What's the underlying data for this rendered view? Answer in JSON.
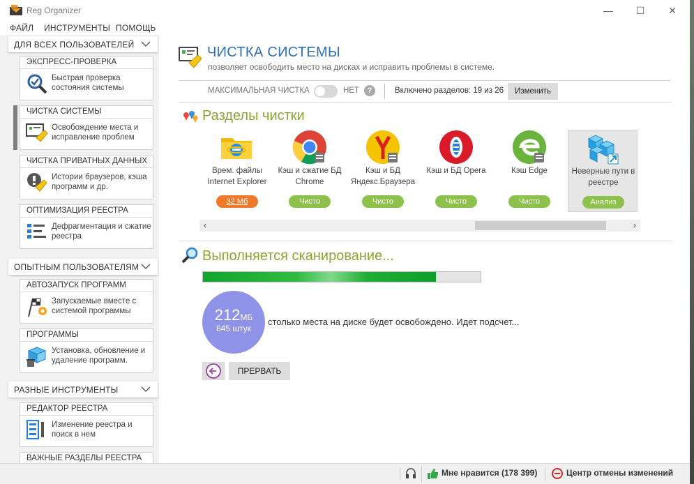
{
  "window": {
    "title": "Reg Organizer",
    "controls": {
      "minimize": "—",
      "maximize": "☐",
      "close": "✕"
    }
  },
  "menu": [
    "ФАЙЛ",
    "ИНСТРУМЕНТЫ",
    "ПОМОЩЬ"
  ],
  "sidebar": {
    "groups": [
      {
        "label": "ДЛЯ ВСЕХ ПОЛЬЗОВАТЕЛЕЙ",
        "items": [
          {
            "title": "ЭКСПРЕСС-ПРОВЕРКА",
            "desc": "Быстрая проверка состояния системы",
            "icon": "magnifier-check-icon"
          },
          {
            "title": "ЧИСТКА СИСТЕМЫ",
            "desc": "Освобождение места и исправление проблем",
            "icon": "system-clean-icon",
            "active": true
          },
          {
            "title": "ЧИСТКА ПРИВАТНЫХ ДАННЫХ",
            "desc": "Истории браузеров, кэша программ и др.",
            "icon": "privacy-clean-icon"
          },
          {
            "title": "ОПТИМИЗАЦИЯ РЕЕСТРА",
            "desc": "Дефрагментация и сжатие реестра",
            "icon": "registry-defrag-icon"
          }
        ]
      },
      {
        "label": "ОПЫТНЫМ ПОЛЬЗОВАТЕЛЯМ",
        "items": [
          {
            "title": "АВТОЗАПУСК ПРОГРАММ",
            "desc": "Запускаемые вместе с системой программы",
            "icon": "autorun-flag-icon"
          },
          {
            "title": "ПРОГРАММЫ",
            "desc": "Установка, обновление и удаление программ.",
            "icon": "programs-box-icon"
          }
        ]
      },
      {
        "label": "РАЗНЫЕ ИНСТРУМЕНТЫ",
        "items": [
          {
            "title": "РЕДАКТОР РЕЕСТРА",
            "desc": "Изменение реестра и поиск в нем",
            "icon": "registry-editor-icon"
          },
          {
            "title": "ВАЖНЫЕ РАЗДЕЛЫ РЕЕСТРА",
            "desc": "",
            "icon": ""
          }
        ]
      }
    ]
  },
  "main": {
    "title": "ЧИСТКА СИСТЕМЫ",
    "subtitle": "позволяет освободить место на дисках и исправить проблемы в системе.",
    "options": {
      "max_clean_label": "МАКСИМАЛЬНАЯ ЧИСТКА",
      "max_clean_value": "НЕТ",
      "help": "?",
      "sections_count": "Включено разделов: 19 из 26",
      "change_button": "Изменить"
    },
    "sections_title": "Разделы чистки",
    "sections": [
      {
        "name": "Врем. файлы Internet Explorer",
        "status": "32 Мб",
        "status_color": "#f07a2a",
        "icon": "ie-temp-folder-icon"
      },
      {
        "name": "Кэш и сжатие БД Chrome",
        "status": "Чисто",
        "status_color": "#8cc24c",
        "icon": "chrome-icon"
      },
      {
        "name": "Кэш и БД Яндекс.Браузера",
        "status": "Чисто",
        "status_color": "#8cc24c",
        "icon": "yandex-browser-icon"
      },
      {
        "name": "Кэш и БД Opera",
        "status": "Чисто",
        "status_color": "#8cc24c",
        "icon": "opera-icon"
      },
      {
        "name": "Кэш Edge",
        "status": "Чисто",
        "status_color": "#8cc24c",
        "icon": "edge-icon"
      },
      {
        "name": "Неверные пути в реестре",
        "status": "Анализ",
        "status_color": "#8cc24c",
        "icon": "registry-paths-icon",
        "selected": true
      }
    ],
    "scroll": {
      "left": "‹",
      "right": "›"
    },
    "scan": {
      "title": "Выполняется сканирование...",
      "progress": 0.84,
      "size_value": "212",
      "size_unit": "МБ",
      "count": "845 штук",
      "message": "столько места на диске будет освобождено. Идет подсчет...",
      "stop_button": "ПРЕРВАТЬ"
    }
  },
  "statusbar": {
    "likes": "Мне нравится (178 399)",
    "undo_center": "Центр отмены изменений"
  },
  "colors": {
    "title_blue": "#2f6fb3",
    "section_green": "#8aa634",
    "progress_green": "#1fae36",
    "circle_purple": "#8f93e8"
  }
}
